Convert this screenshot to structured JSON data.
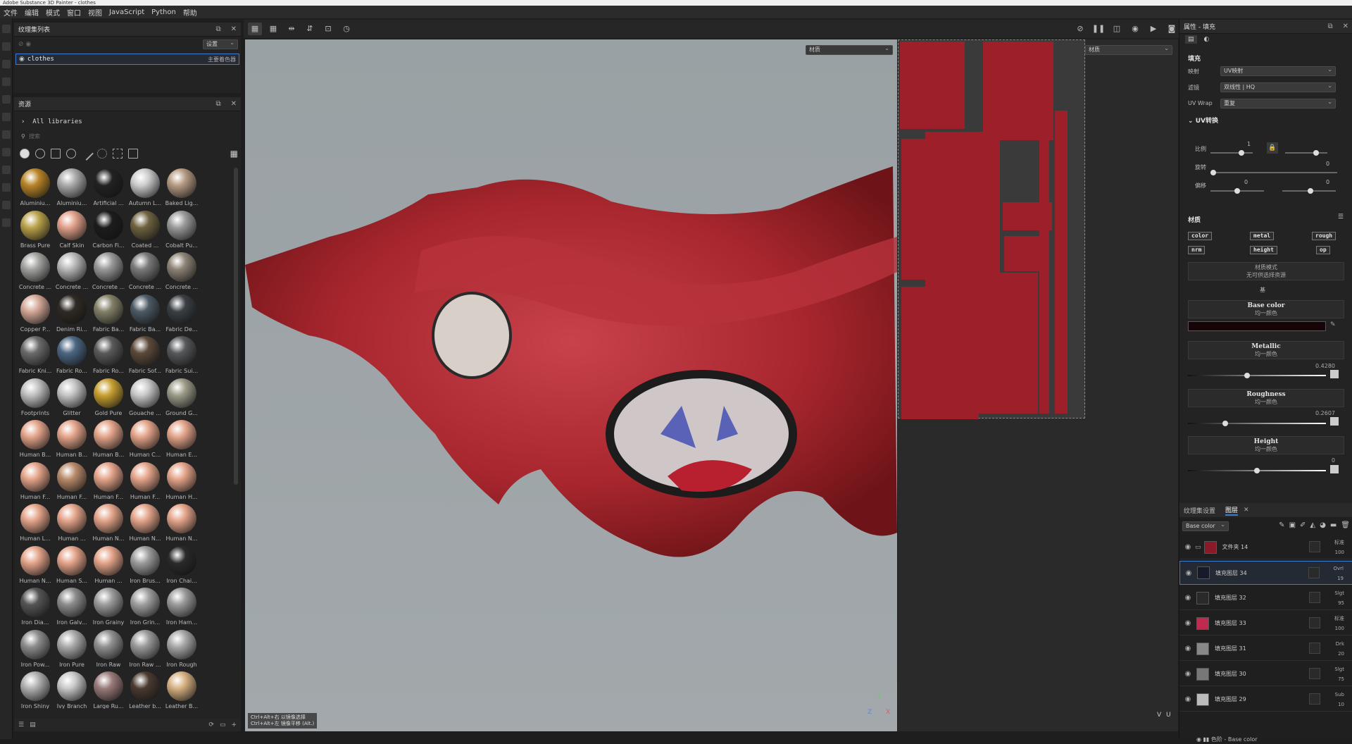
{
  "window": {
    "title": "Adobe Substance 3D Painter - clothes"
  },
  "menu": [
    "文件",
    "编辑",
    "模式",
    "窗口",
    "视图",
    "JavaScript",
    "Python",
    "帮助"
  ],
  "texture_set_panel": {
    "title": "纹理集列表",
    "settings_label": "设置",
    "set_name": "clothes",
    "shader": "主要着色器"
  },
  "assets_panel": {
    "title": "资源",
    "libraries": "All libraries",
    "search_placeholder": "搜索",
    "items": [
      "Aluminiu...",
      "Aluminiu...",
      "Artificial ...",
      "Autumn L...",
      "Baked Lig...",
      "Brass Pure",
      "Calf Skin",
      "Carbon Fi...",
      "Coated ...",
      "Cobalt Pu...",
      "Concrete ...",
      "Concrete ...",
      "Concrete ...",
      "Concrete ...",
      "Concrete ...",
      "Copper P...",
      "Denim Ri...",
      "Fabric Ba...",
      "Fabric Ba...",
      "Fabric De...",
      "Fabric Kni...",
      "Fabric Ro...",
      "Fabric Ro...",
      "Fabric Sof...",
      "Fabric Sui...",
      "Footprints",
      "Glitter",
      "Gold Pure",
      "Gouache ...",
      "Ground G...",
      "Human B...",
      "Human B...",
      "Human B...",
      "Human C...",
      "Human E...",
      "Human F...",
      "Human F...",
      "Human F...",
      "Human F...",
      "Human H...",
      "Human L...",
      "Human ...",
      "Human N...",
      "Human N...",
      "Human N...",
      "Human N...",
      "Human S...",
      "Human ...",
      "Iron Brus...",
      "Iron Chai...",
      "Iron Dia...",
      "Iron Galv...",
      "Iron Grainy",
      "Iron Grin...",
      "Iron Ham...",
      "Iron Pow...",
      "Iron Pure",
      "Iron Raw",
      "Iron Raw ...",
      "Iron Rough",
      "Iron Shiny",
      "Ivy Branch",
      "Large Ru...",
      "Leather b...",
      "Leather B..."
    ],
    "colors": [
      "#b88428",
      "#aaaaaa",
      "#222222",
      "#cccccc",
      "#b59a82",
      "#b9a24a",
      "#e0a08a",
      "#1c1c1c",
      "#6e6240",
      "#9a9a9a",
      "#a3a3a0",
      "#b8b8b8",
      "#999",
      "#7a7a7a",
      "#8d8375",
      "#d5a898",
      "#302a24",
      "#838068",
      "#4c5a65",
      "#3a3f44",
      "#6b6b6b",
      "#4c6682",
      "#5a5a5a",
      "#5c4a3a",
      "#56585a",
      "#c0c0c0",
      "#c4c4c4",
      "#c8a030",
      "#c9c9c9",
      "#9c9a88",
      "#e4a48a",
      "#e4a48a",
      "#e4a48a",
      "#e4a48a",
      "#e4a48a",
      "#e4a48a",
      "#b88a6a",
      "#e4a48a",
      "#e4a48a",
      "#e4a48a",
      "#e4a48a",
      "#e4a48a",
      "#e4a48a",
      "#e4a48a",
      "#e4a48a",
      "#e4a48a",
      "#e4a48a",
      "#e4a48a",
      "#9c9c9c",
      "#2a2a2a",
      "#555555",
      "#8c8c8c",
      "#9c9c9c",
      "#a0a0a0",
      "#9a9a9a",
      "#8c8c8c",
      "#aaaaaa",
      "#909090",
      "#9a9a9a",
      "#a8a8a8",
      "#b0b0b0",
      "#c8c8c8",
      "#9a7a7a",
      "#4a3a30",
      "#d6b080"
    ]
  },
  "viewport": {
    "material_dropdown_3d": "材质",
    "material_dropdown_2d": "材质",
    "hint_line1": "Ctrl+Alt+右 以镜像选择",
    "hint_line2": "Ctrl+Alt+左 镜像平移 (Alt.)",
    "axis_y": "Y",
    "axis_z": "Z",
    "axis_x": "X",
    "axis_u": "U",
    "axis_v": "V"
  },
  "properties": {
    "title": "属性 - 填充",
    "fill_section": "填充",
    "mapping_label": "映射",
    "mapping_value": "UV映射",
    "filter_label": "滤镜",
    "filter_value": "双线性 | HQ",
    "uvwrap_label": "UV Wrap",
    "uvwrap_value": "重复",
    "uv_transform": "UV转换",
    "scale_label": "比例",
    "scale_value": "1",
    "rotate_label": "旋转",
    "rotate_value": "0",
    "offset_label": "偏移",
    "offset_u": "0",
    "offset_v": "0",
    "material_section": "材质",
    "channels": [
      "color",
      "metal",
      "rough",
      "nrm",
      "height",
      "op"
    ],
    "material_mode_label": "材质模式",
    "material_mode_value": "无可供选择资源",
    "base_label": "基",
    "base_color_title": "Base color",
    "base_color_sub": "均一颜色",
    "base_color_hex": "#160406",
    "metallic_title": "Metallic",
    "metallic_sub": "均一颜色",
    "metallic_value": "0.4280",
    "roughness_title": "Roughness",
    "roughness_sub": "均一颜色",
    "roughness_value": "0.2607",
    "height_title": "Height",
    "height_sub": "均一颜色",
    "height_value": "0"
  },
  "layers_panel": {
    "tab1": "纹理集设置",
    "tab2": "图层",
    "channel_dropdown": "Base color",
    "layers": [
      {
        "name": "文件夹 14",
        "blend": "标准",
        "opacity": "100",
        "thumb": "#8a1a2a"
      },
      {
        "name": "填充图层 34",
        "blend": "Ovrl",
        "opacity": "19",
        "thumb": "#161a2a"
      },
      {
        "name": "填充图层 32",
        "blend": "Slgt",
        "opacity": "95",
        "thumb": "#2a2a2a"
      },
      {
        "name": "填充图层 33",
        "blend": "标准",
        "opacity": "100",
        "thumb": "#c02a50"
      },
      {
        "name": "填充图层 31",
        "blend": "Drk",
        "opacity": "20",
        "thumb": "#888888"
      },
      {
        "name": "填充图层 30",
        "blend": "Slgt",
        "opacity": "75",
        "thumb": "#777777"
      },
      {
        "name": "填充图层 29",
        "blend": "Sub",
        "opacity": "10",
        "thumb": "#bbbbbb"
      }
    ],
    "footer": "色阶 - Base color"
  }
}
